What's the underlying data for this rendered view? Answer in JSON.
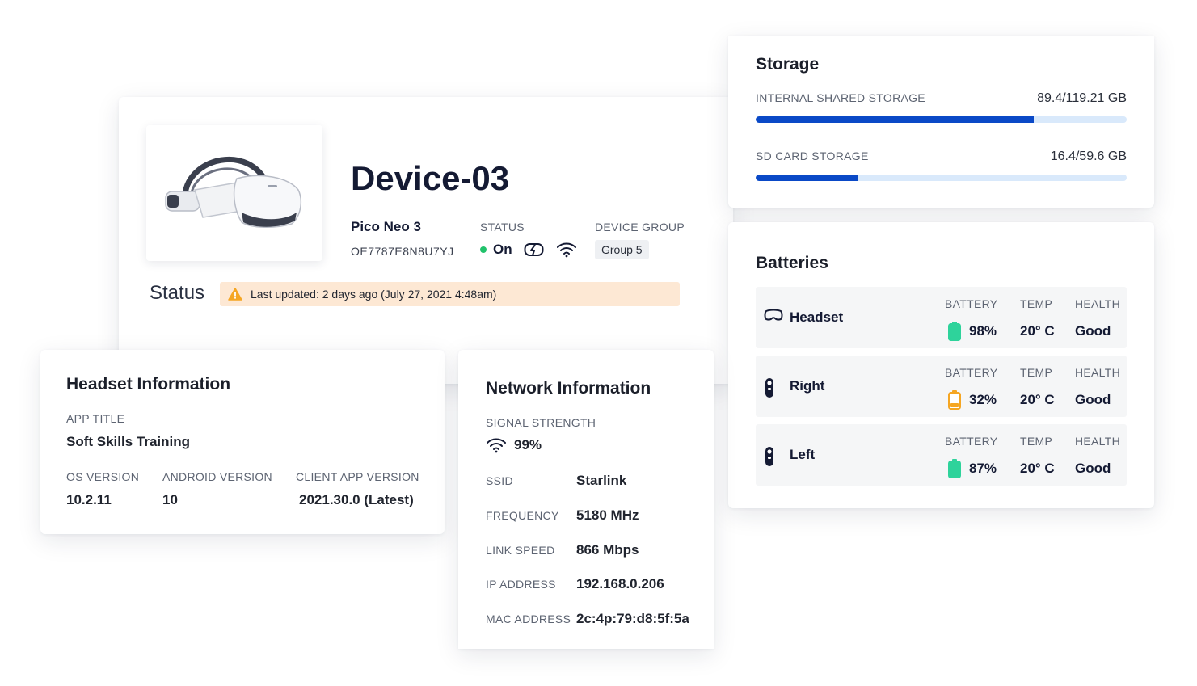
{
  "device": {
    "name": "Device-03",
    "model": "Pico Neo 3",
    "serial": "OE7787E8N8U7YJ",
    "status_label": "STATUS",
    "status_value": "On",
    "group_label": "DEVICE GROUP",
    "group_value": "Group 5",
    "status_heading": "Status",
    "last_updated": "Last updated: 2 days ago (July 27, 2021 4:48am)"
  },
  "headset_info": {
    "title": "Headset Information",
    "app_title_label": "APP TITLE",
    "app_title_value": "Soft Skills Training",
    "os_label": "OS VERSION",
    "os_value": "10.2.11",
    "android_label": "ANDROID VERSION",
    "android_value": "10",
    "client_label": "CLIENT APP VERSION",
    "client_value": "2021.30.0 (Latest)"
  },
  "network_info": {
    "title": "Network Information",
    "signal_label": "SIGNAL STRENGTH",
    "signal_value": "99%",
    "rows": [
      {
        "label": "SSID",
        "value": "Starlink"
      },
      {
        "label": "FREQUENCY",
        "value": "5180 MHz"
      },
      {
        "label": "LINK SPEED",
        "value": "866 Mbps"
      },
      {
        "label": "IP ADDRESS",
        "value": "192.168.0.206"
      },
      {
        "label": "MAC ADDRESS",
        "value": "2c:4p:79:d8:5f:5a"
      }
    ]
  },
  "storage": {
    "title": "Storage",
    "items": [
      {
        "label": "INTERNAL SHARED STORAGE",
        "amount": "89.4/119.21 GB",
        "used_fraction": 0.75
      },
      {
        "label": "SD CARD STORAGE",
        "amount": "16.4/59.6 GB",
        "used_fraction": 0.275
      }
    ]
  },
  "batteries": {
    "title": "Batteries",
    "battery_label": "BATTERY",
    "temp_label": "TEMP",
    "health_label": "HEALTH",
    "items": [
      {
        "name": "Headset",
        "icon": "headset-icon",
        "battery": "98%",
        "level": 0.98,
        "color": "#2ed39b",
        "temp": "20° C",
        "health": "Good"
      },
      {
        "name": "Right",
        "icon": "controller-icon",
        "battery": "32%",
        "level": 0.32,
        "color": "#f5a623",
        "temp": "20° C",
        "health": "Good"
      },
      {
        "name": "Left",
        "icon": "controller-icon",
        "battery": "87%",
        "level": 0.87,
        "color": "#2ed39b",
        "temp": "20° C",
        "health": "Good"
      }
    ]
  },
  "colors": {
    "accent": "#0a49c7",
    "bar_track": "#d9e9fb",
    "status_on": "#21c26b",
    "warning_bg": "#fde8d4",
    "warning_icon": "#f5a623"
  }
}
